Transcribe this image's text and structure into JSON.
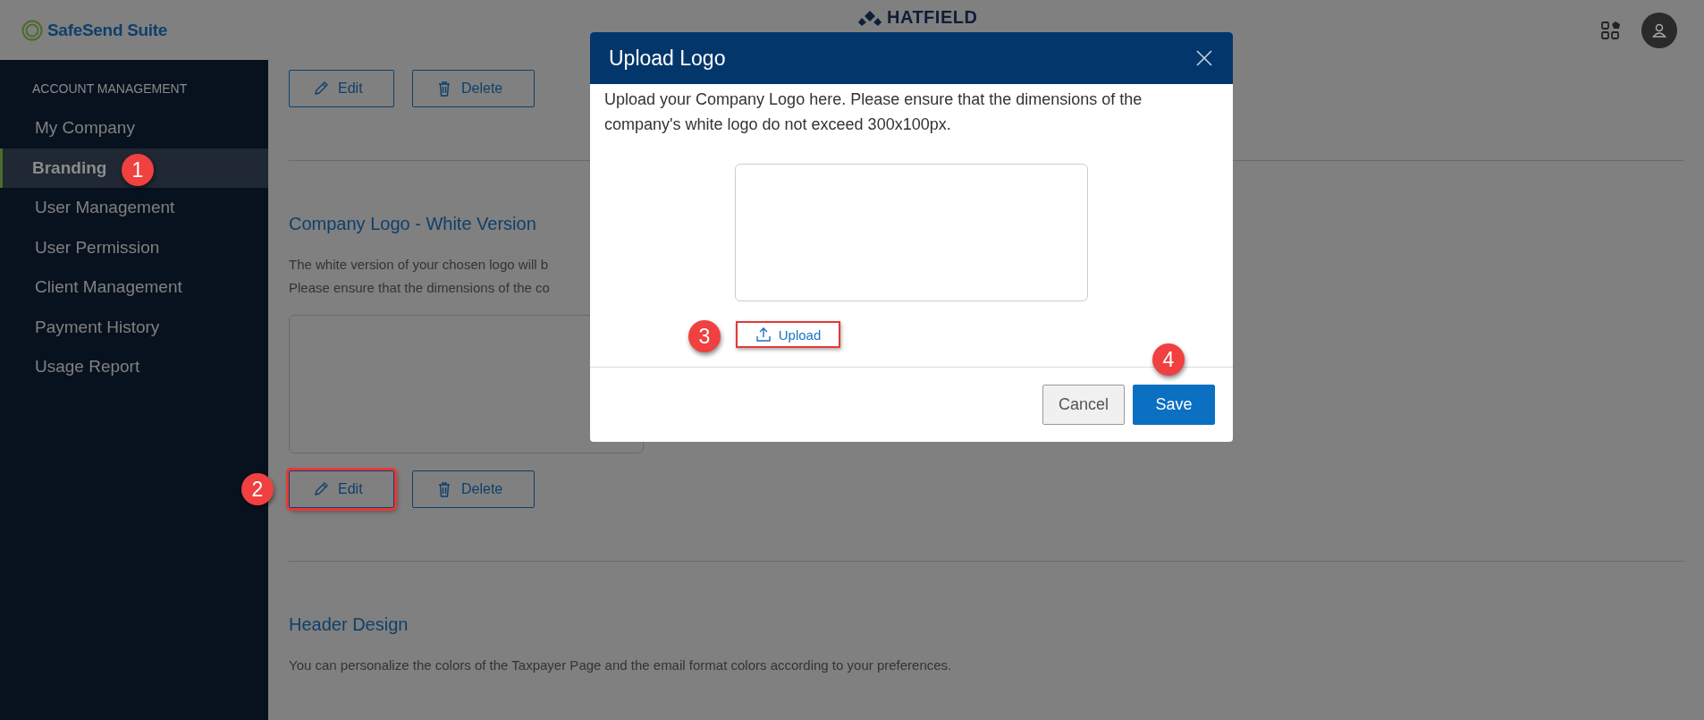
{
  "header": {
    "brand": "SafeSend Suite",
    "center_logo": "HATFIELD"
  },
  "sidebar": {
    "section": "ACCOUNT MANAGEMENT",
    "items": [
      {
        "label": "My Company",
        "selected": false
      },
      {
        "label": "Branding",
        "selected": true
      },
      {
        "label": "User Management",
        "selected": false
      },
      {
        "label": "User Permission",
        "selected": false
      },
      {
        "label": "Client Management",
        "selected": false
      },
      {
        "label": "Payment History",
        "selected": false
      },
      {
        "label": "Usage Report",
        "selected": false
      }
    ]
  },
  "content": {
    "top_actions": [
      {
        "label": "Edit",
        "kind": "edit",
        "highlighted": false
      },
      {
        "label": "Delete",
        "kind": "delete",
        "highlighted": false
      }
    ],
    "sections": [
      {
        "title": "Company Logo - White Version",
        "description": [
          "The white version of your chosen logo will b",
          "Please ensure that the dimensions of the co"
        ],
        "kind": "logo",
        "actions": [
          {
            "label": "Edit",
            "kind": "edit",
            "highlighted": true
          },
          {
            "label": "Delete",
            "kind": "delete",
            "highlighted": false
          }
        ]
      },
      {
        "title": "Header Design",
        "description": [
          "You can personalize the colors of the Taxpayer Page and the email format colors according to your preferences."
        ],
        "kind": "text"
      }
    ]
  },
  "dialog": {
    "title": "Upload Logo",
    "message": "Upload your Company Logo here. Please ensure that the dimensions of the company's white logo do not exceed 300x100px.",
    "upload_button": {
      "label": "Upload",
      "highlighted": true
    },
    "buttons": [
      {
        "label": "Cancel",
        "kind": "secondary"
      },
      {
        "label": "Save",
        "kind": "primary"
      }
    ]
  },
  "annotations": [
    "1",
    "2",
    "3",
    "4"
  ]
}
